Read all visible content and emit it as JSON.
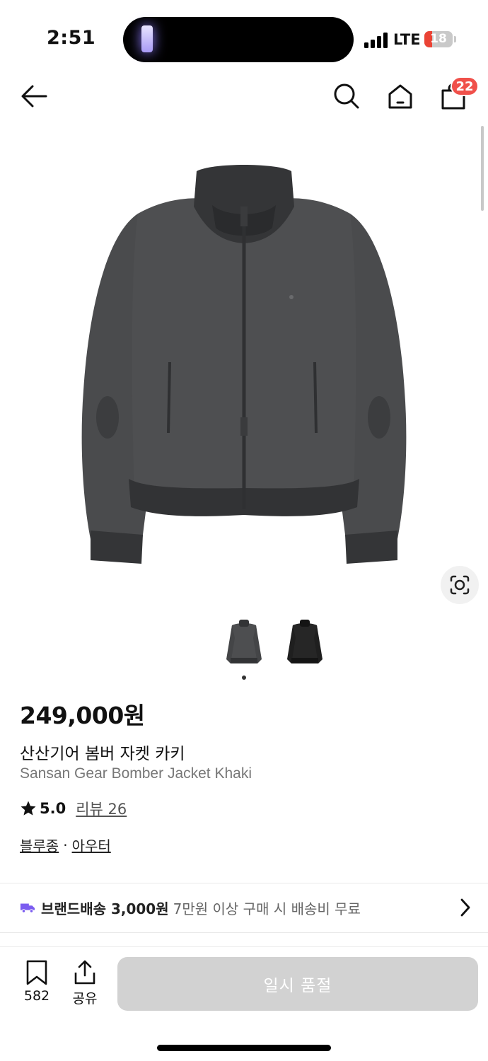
{
  "status": {
    "time": "2:51",
    "network": "LTE",
    "battery": "18"
  },
  "nav": {
    "cart_count": "22"
  },
  "product": {
    "price": "249,000원",
    "name_ko": "산산기어 봄버 자켓 카키",
    "name_en": "Sansan Gear Bomber Jacket Khaki",
    "rating": "5.0",
    "review_label": "리뷰 26",
    "category_1": "블루종",
    "category_sep": "·",
    "category_2": "아우터"
  },
  "shipping": {
    "label": "브랜드배송 3,000원",
    "note": "7만원 이상 구매 시 배송비 무료"
  },
  "bottom": {
    "bookmark_count": "582",
    "share_label": "공유",
    "buy_label": "일시 품절"
  },
  "colors": {
    "badge": "#f0504a",
    "truck": "#7b5cf0",
    "soldout": "#d2d2d2"
  }
}
